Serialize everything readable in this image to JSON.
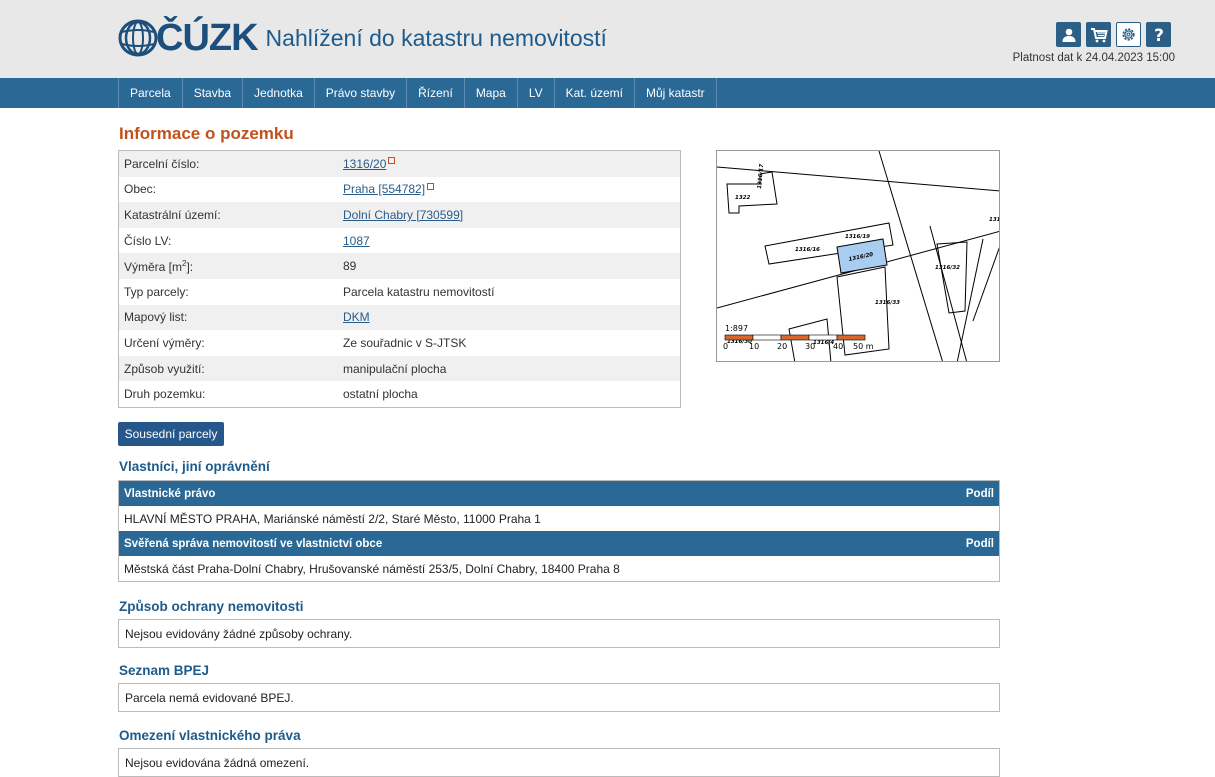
{
  "header": {
    "logo_text": "ČÚZK",
    "app_title": "Nahlížení do katastru nemovitostí",
    "validity": "Platnost dat k 24.04.2023 15:00",
    "icons": [
      "user-icon",
      "cart-icon",
      "gear-icon",
      "help-icon"
    ]
  },
  "nav": {
    "items": [
      {
        "label": "Parcela"
      },
      {
        "label": "Stavba"
      },
      {
        "label": "Jednotka"
      },
      {
        "label": "Právo stavby"
      },
      {
        "label": "Řízení"
      },
      {
        "label": "Mapa"
      },
      {
        "label": "LV"
      },
      {
        "label": "Kat. území"
      },
      {
        "label": "Můj katastr"
      }
    ]
  },
  "parcel": {
    "heading": "Informace o pozemku",
    "rows": [
      {
        "label": "Parcelní číslo:",
        "value": "1316/20"
      },
      {
        "label": "Obec:",
        "value": "Praha [554782]"
      },
      {
        "label": "Katastrální území:",
        "value": "Dolní Chabry [730599]"
      },
      {
        "label": "Číslo LV:",
        "value": "1087"
      },
      {
        "label": "Výměra [m",
        "label_sup": "2",
        "label_end": "]:",
        "value": "89"
      },
      {
        "label": "Typ parcely:",
        "value": "Parcela katastru nemovitostí"
      },
      {
        "label": "Mapový list:",
        "value": "DKM"
      },
      {
        "label": "Určení výměry:",
        "value": "Ze souřadnic v S-JTSK"
      },
      {
        "label": "Způsob využití:",
        "value": "manipulační plocha"
      },
      {
        "label": "Druh pozemku:",
        "value": "ostatní plocha"
      }
    ],
    "neighbors_button": "Sousední parcely"
  },
  "map": {
    "scale": "1:897",
    "scale_ticks": [
      "0",
      "10",
      "20",
      "30",
      "40",
      "50 m"
    ],
    "parcel_labels": [
      "1322",
      "1316/17",
      "1316/16",
      "1316/19",
      "1316/20",
      "1316/33",
      "1316/32",
      "1316/30",
      "1316/4",
      "131"
    ],
    "highlight_color": "#a9cdf0",
    "scalebar_color": "#d9662a"
  },
  "owners": {
    "heading": "Vlastníci, jiní oprávnění",
    "groups": [
      {
        "title": "Vlastnické právo",
        "share_label": "Podíl",
        "entry": "HLAVNÍ MĚSTO PRAHA, Mariánské náměstí 2/2, Staré Město, 11000 Praha 1"
      },
      {
        "title": "Svěřená správa nemovitostí ve vlastnictví obce",
        "share_label": "Podíl",
        "entry": "Městská část Praha-Dolní Chabry, Hrušovanské náměstí 253/5, Dolní Chabry, 18400 Praha 8"
      }
    ]
  },
  "protection": {
    "heading": "Způsob ochrany nemovitosti",
    "text": "Nejsou evidovány žádné způsoby ochrany."
  },
  "bpej": {
    "heading": "Seznam BPEJ",
    "text": "Parcela nemá evidované BPEJ."
  },
  "restrictions": {
    "heading": "Omezení vlastnického práva",
    "text": "Nejsou evidována žádná omezení."
  }
}
